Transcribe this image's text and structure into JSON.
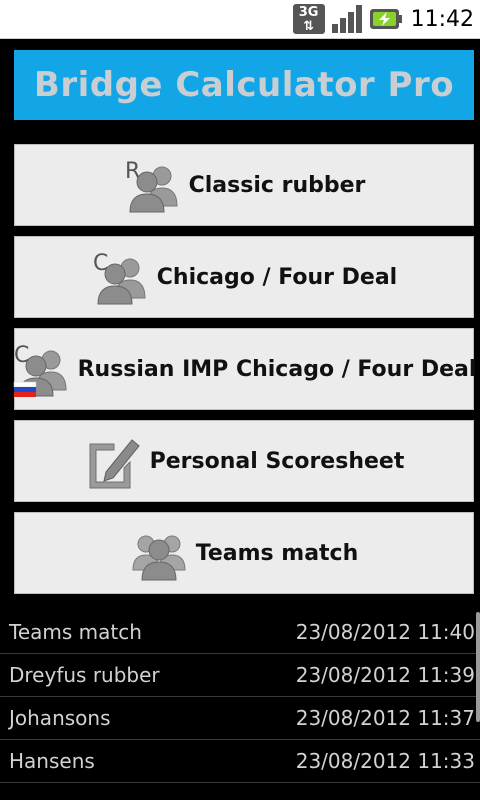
{
  "status_bar": {
    "network": "3G",
    "time": "11:42"
  },
  "app": {
    "title": "Bridge Calculator Pro"
  },
  "menu": {
    "items": [
      {
        "label": "Classic rubber",
        "icon": "rubber-players-icon",
        "badge": "R"
      },
      {
        "label": "Chicago / Four Deal",
        "icon": "chicago-players-icon",
        "badge": "C"
      },
      {
        "label": "Russian IMP Chicago / Four Deal",
        "icon": "russian-chicago-players-icon",
        "badge": "C"
      },
      {
        "label": "Personal Scoresheet",
        "icon": "scoresheet-pencil-icon"
      },
      {
        "label": "Teams match",
        "icon": "teams-players-icon"
      }
    ]
  },
  "history": {
    "rows": [
      {
        "name": "Teams match",
        "date": "23/08/2012 11:40"
      },
      {
        "name": "Dreyfus rubber",
        "date": "23/08/2012 11:39"
      },
      {
        "name": "Johansons",
        "date": "23/08/2012 11:37"
      },
      {
        "name": "Hansens",
        "date": "23/08/2012 11:33"
      }
    ]
  }
}
